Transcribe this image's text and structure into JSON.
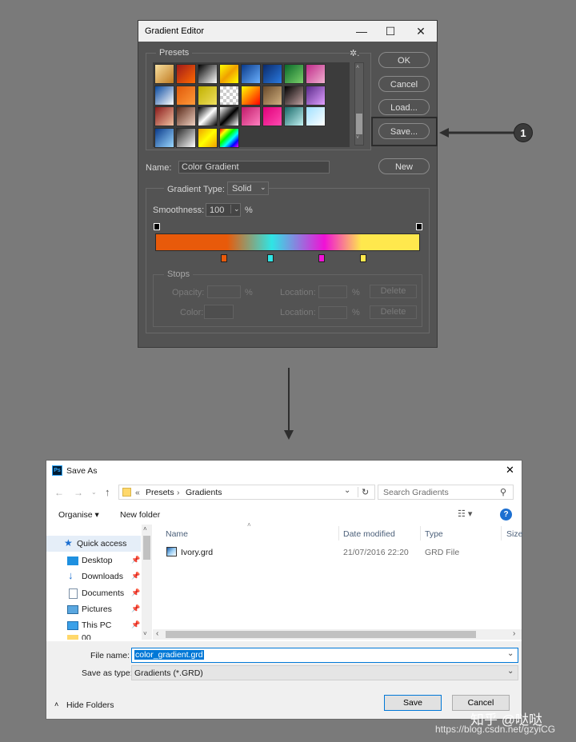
{
  "gradient_editor": {
    "title": "Gradient Editor",
    "window_controls": {
      "minimize": "—",
      "maximize": "☐",
      "close": "✕"
    },
    "presets_label": "Presets",
    "settings_glyph": "✲.",
    "buttons": {
      "ok": "OK",
      "cancel": "Cancel",
      "load": "Load...",
      "save": "Save...",
      "new": "New"
    },
    "name_label": "Name:",
    "name_value": "Color Gradient",
    "gradient_type_label": "Gradient Type:",
    "gradient_type_value": "Solid",
    "smoothness_label": "Smoothness:",
    "smoothness_value": "100",
    "percent": "%",
    "stops_label": "Stops",
    "opacity_label": "Opacity:",
    "color_label": "Color:",
    "location_label": "Location:",
    "delete_label": "Delete",
    "callout_number": "1",
    "colors": {
      "orange": "#e85a0a",
      "cyan": "#2fe5e5",
      "magenta": "#f011d6",
      "yellow": "#ffe84d"
    }
  },
  "save_as": {
    "title": "Save As",
    "app_badge": "Ps",
    "close": "✕",
    "breadcrumb": {
      "prefix": "«",
      "items": [
        "Presets",
        "Gradients"
      ]
    },
    "search_placeholder": "Search Gradients",
    "toolbar": {
      "organise": "Organise ▾",
      "new_folder": "New folder",
      "help": "?"
    },
    "nav": [
      "Quick access",
      "Desktop",
      "Downloads",
      "Documents",
      "Pictures",
      "This PC",
      "00"
    ],
    "columns": {
      "name": "Name",
      "date_modified": "Date modified",
      "type": "Type",
      "size": "Size"
    },
    "files": [
      {
        "name": "Ivory.grd",
        "date_modified": "21/07/2016 22:20",
        "type": "GRD File"
      }
    ],
    "file_name_label": "File name:",
    "file_name_value": "color_gradient.grd",
    "save_as_type_label": "Save as type:",
    "save_as_type_value": "Gradients (*.GRD)",
    "hide_folders": "Hide Folders",
    "save_button": "Save",
    "cancel_button": "Cancel"
  },
  "watermark": {
    "line1": "知乎 @哒哒",
    "line2": "https://blog.csdn.net/gzyiCG"
  }
}
